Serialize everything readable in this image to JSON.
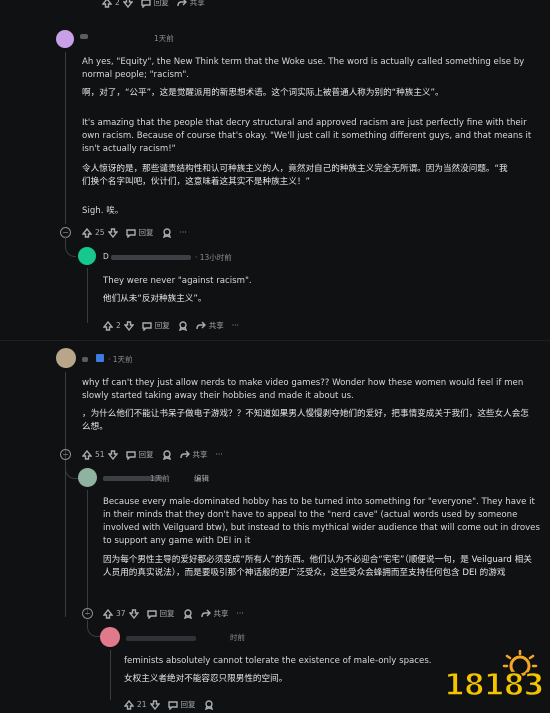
{
  "top_actions": {
    "count": "2",
    "reply": "回复",
    "share": "共享"
  },
  "c1": {
    "time": "1天前",
    "p1": "Ah yes, \"Equity\", the New Think term that the Woke use. The word is actually called something else by normal people; \"racism\".",
    "p1_zh": "啊，对了，“公平”，这是觉醒派用的新思想术语。这个词实际上被普通人称为别的“种族主义”。",
    "p2": "It's amazing that the people that decry structural and approved racism are just perfectly fine with their own racism. Because of course that's okay. \"We'll just call it something different guys, and that means it isn't actually racism!\"",
    "p2_zh": "令人惊讶的是，那些谴责结构性和认可种族主义的人，竟然对自己的种族主义完全无所谓。因为当然没问题。“我们换个名字叫吧，伙计们，这意味着这其实不是种族主义！”",
    "p3": "Sigh.  唉。",
    "votes": "25",
    "reply": "回复"
  },
  "c2": {
    "user": "D",
    "time": "· 13小时前",
    "text": "They were never \"against racism\".",
    "text_zh": "他们从未“反对种族主义”。",
    "votes": "2",
    "reply": "回复",
    "share": "共享"
  },
  "c3": {
    "time": "· 1天前",
    "text": "why tf can't they just allow nerds to make video games?? Wonder how these women would feel if men slowly started taking away their hobbies and made it about us.",
    "text_zh": "，为什么他们不能让书呆子做电子游戏？？不知道如果男人慢慢剥夺她们的爱好，把事情变成关于我们，这些女人会怎么想。",
    "votes": "51",
    "reply": "回复",
    "share": "共享"
  },
  "c4": {
    "time": "1天前",
    "edited": "编辑",
    "text": "Because every male-dominated hobby has to be turned into something for \"everyone\". They have it in their minds that they don't have to appeal to the \"nerd cave\" (actual words used by someone involved with Veilguard btw), but instead to this mythical wider audience that will come out in droves to support any game with DEI in it",
    "text_zh": "因为每个男性主导的爱好都必须变成“所有人”的东西。他们认为不必迎合“宅宅”（顺便说一句，是 Veilguard 相关人员用的真实说法），而是要吸引那个神话般的更广泛受众，这些受众会蜂拥而至支持任何包含 DEI 的游戏",
    "votes": "37",
    "reply": "回复",
    "share": "共享"
  },
  "c5": {
    "time": "时前",
    "text": "feminists absolutely cannot tolerate the existence of male-only spaces.",
    "text_zh": "女权主义者绝对不能容忍只限男性的空间。",
    "votes": "21",
    "reply": "回复"
  },
  "watermark": "18183"
}
